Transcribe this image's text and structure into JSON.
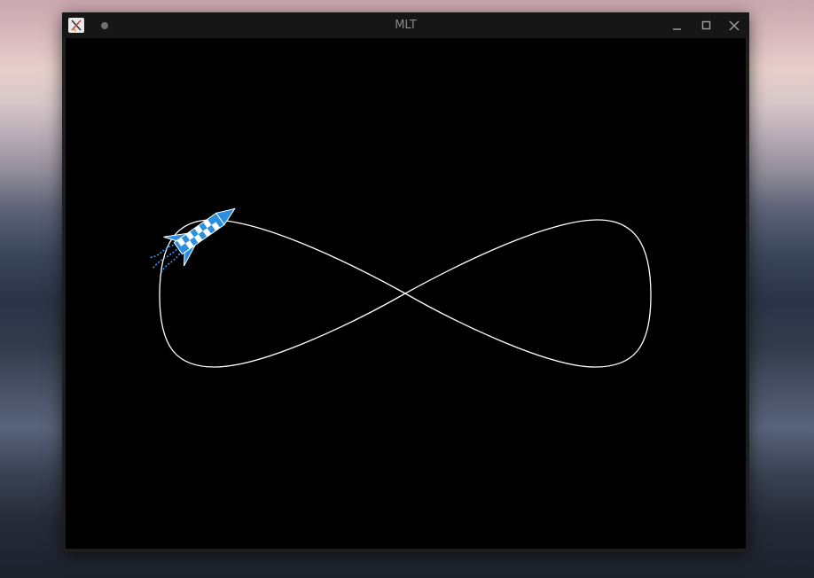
{
  "window": {
    "title": "MLT",
    "app_icon": "mlt-app-icon",
    "controls": [
      "minimize-icon",
      "maximize-icon",
      "close-icon"
    ]
  },
  "scene": {
    "path_shape": "figure-eight",
    "path_color": "#ffffff",
    "sprite": "rocket-icon",
    "rocket_colors": {
      "body": "#2a8fe0",
      "checker": "#ffffff",
      "exhaust": "#3aa0ff"
    }
  }
}
